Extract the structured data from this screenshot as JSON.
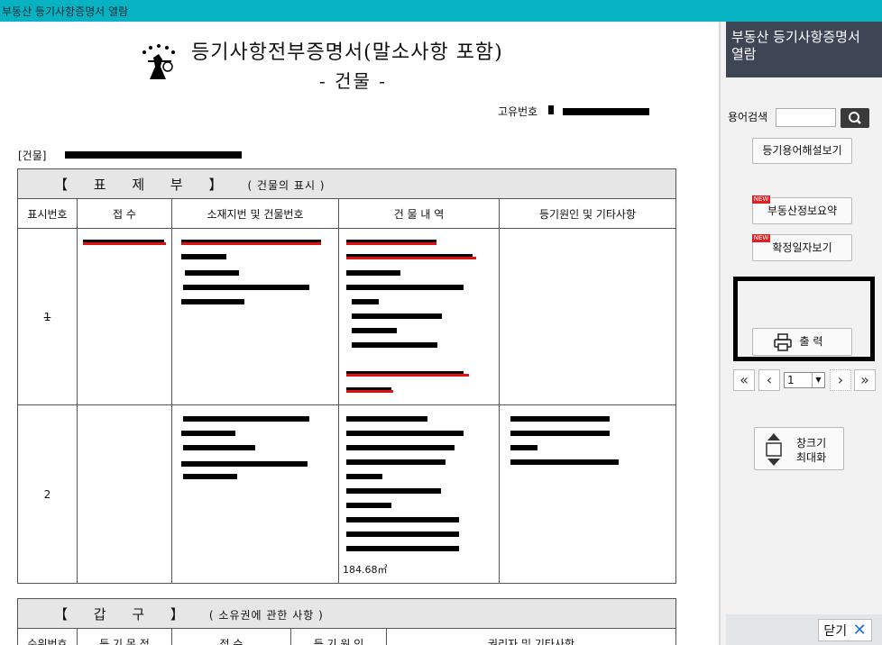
{
  "window": {
    "title": "부동산 등기사항증명서 열람"
  },
  "document": {
    "title": "등기사항전부증명서(말소사항 포함)",
    "subtitle": "- 건물 -",
    "unique_no_label": "고유번호",
    "building_label": "[건물]",
    "section1": {
      "heading": "【 표 제 부 】",
      "subheading": "( 건물의 표시 )",
      "columns": [
        "표시번호",
        "접 수",
        "소재지번 및 건물번호",
        "건 물 내 역",
        "등기원인 및 기타사항"
      ],
      "rows": [
        {
          "no": "1",
          "area": ""
        },
        {
          "no": "2",
          "area": "184.68㎡"
        }
      ]
    },
    "section2": {
      "heading": "【 갑 구 】",
      "subheading": "( 소유권에 관한 사항 )",
      "columns": [
        "순위번호",
        "등 기 목 적",
        "접 수",
        "등 기 원 인",
        "권리자 및 기타사항"
      ]
    }
  },
  "panel": {
    "title": "부동산 등기사항증명서 열람",
    "search_label": "용어검색",
    "search_value": "",
    "glossary_button": "등기용어해설보기",
    "summary_button": "부동산정보요약",
    "confirm_button": "확정일자보기",
    "new_badge": "NEW",
    "print_button": "출 력",
    "page_value": "1",
    "maximize_button_line1": "창크기",
    "maximize_button_line2": "최대화",
    "close_button": "닫기"
  },
  "colors": {
    "titlebar": "#07b3c2",
    "panel_header": "#3e4656",
    "strike": "#e01010"
  }
}
